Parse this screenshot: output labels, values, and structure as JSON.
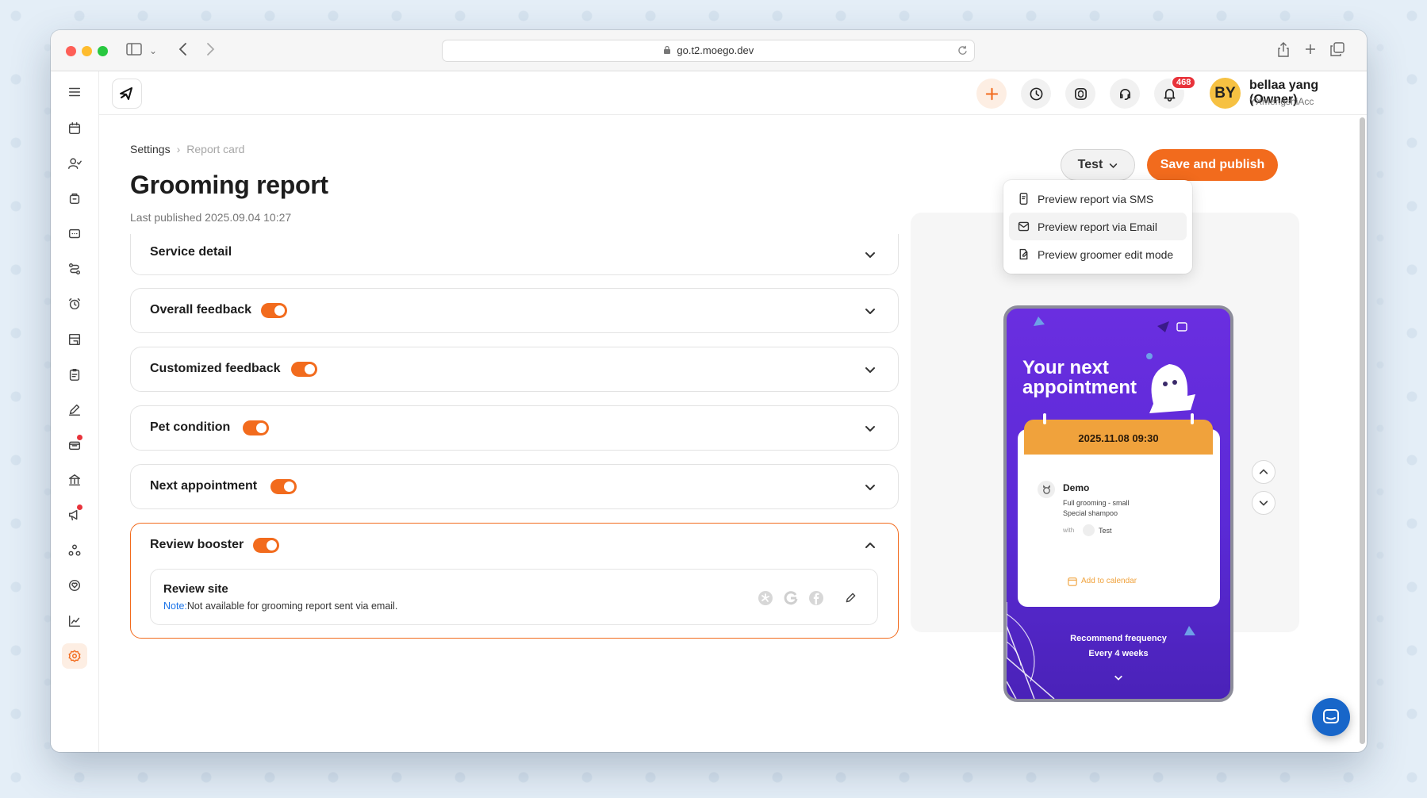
{
  "browser": {
    "url": "go.t2.moego.dev"
  },
  "header": {
    "notification_count": "468",
    "avatar_initials": "BY",
    "user_name": "bellaa yang (Owner)",
    "company": "YXmengshiAcc"
  },
  "breadcrumb": {
    "parent": "Settings",
    "current": "Report card"
  },
  "page": {
    "title": "Grooming report",
    "last_published": "Last published 2025.09.04 10:27"
  },
  "actions": {
    "test_label": "Test",
    "save_label": "Save and publish"
  },
  "test_menu": {
    "items": [
      {
        "label": "Preview report via SMS"
      },
      {
        "label": "Preview report via Email"
      },
      {
        "label": "Preview groomer edit mode"
      }
    ]
  },
  "sections": [
    {
      "title": "Service detail",
      "has_toggle": false
    },
    {
      "title": "Overall feedback",
      "enabled": true
    },
    {
      "title": "Customized feedback",
      "enabled": true
    },
    {
      "title": "Pet condition",
      "enabled": true
    },
    {
      "title": "Next appointment",
      "enabled": true
    },
    {
      "title": "Review booster",
      "enabled": true,
      "expanded": true
    }
  ],
  "review_site": {
    "title": "Review site",
    "note_label": "Note:",
    "note_text": "Not available for grooming report sent via email."
  },
  "preview": {
    "heading_line1": "Your next",
    "heading_line2": "appointment",
    "datetime": "2025.11.08 09:30",
    "pet_name": "Demo",
    "service_1": "Full grooming - small",
    "service_2": "Special shampoo",
    "with_label": "with",
    "staff": "Test",
    "calendar_link": "Add to calendar",
    "frequency_label": "Recommend frequency",
    "frequency_value": "Every 4 weeks"
  },
  "colors": {
    "accent": "#f26b1d",
    "note_blue": "#1a73e8",
    "preview_purple": "#5b2ad6",
    "calendar_orange": "#f0a23c"
  }
}
